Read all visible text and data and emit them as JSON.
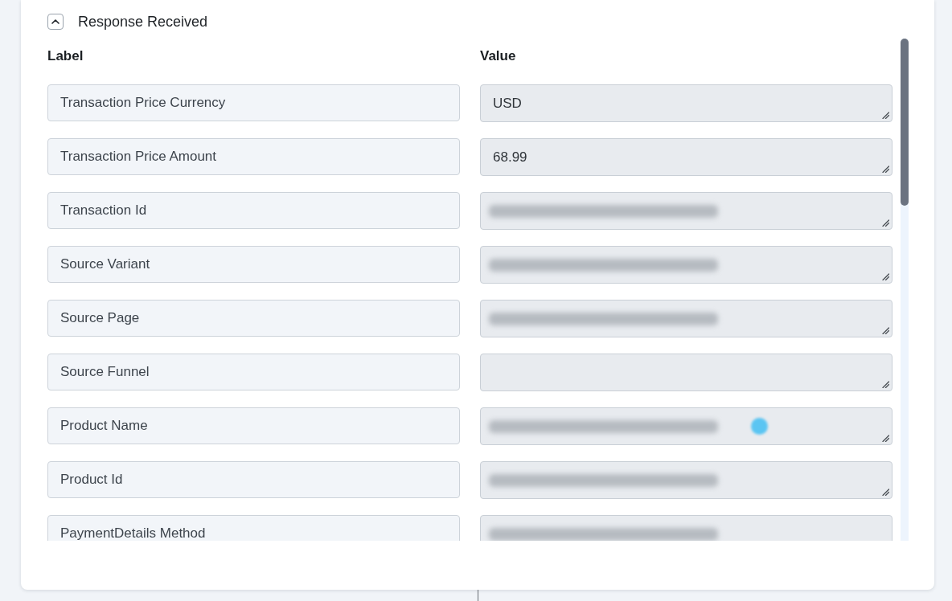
{
  "section": {
    "title": "Response Received",
    "expanded": true
  },
  "columns": {
    "label": "Label",
    "value": "Value"
  },
  "rows": [
    {
      "label": "Transaction Price Currency",
      "value": "USD",
      "redacted": false,
      "emoji": false
    },
    {
      "label": "Transaction Price Amount",
      "value": "68.99",
      "redacted": false,
      "emoji": false
    },
    {
      "label": "Transaction Id",
      "redacted": true,
      "emoji": false
    },
    {
      "label": "Source Variant",
      "redacted": true,
      "emoji": false
    },
    {
      "label": "Source Page",
      "redacted": true,
      "emoji": false
    },
    {
      "label": "Source Funnel",
      "redacted": false,
      "emoji": false
    },
    {
      "label": "Product Name",
      "redacted": true,
      "emoji": true
    },
    {
      "label": "Product Id",
      "redacted": true,
      "emoji": false
    },
    {
      "label": "PaymentDetails Method",
      "redacted": true,
      "emoji": false
    }
  ]
}
